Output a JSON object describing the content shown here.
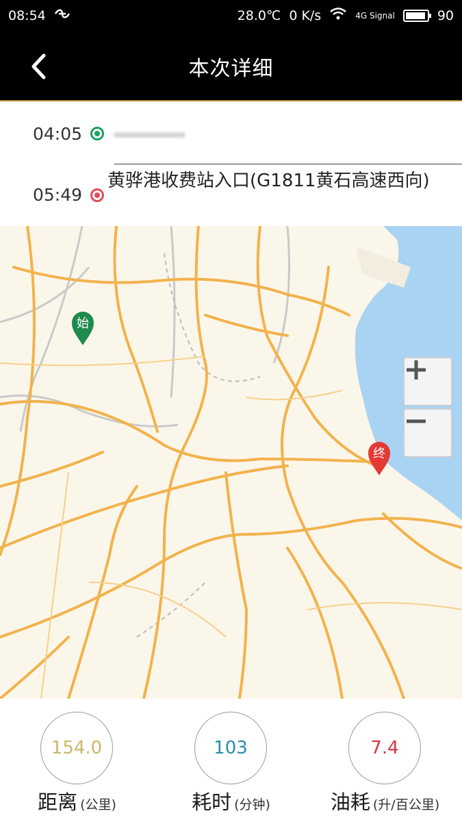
{
  "status_bar": {
    "time": "08:54",
    "temperature": "28.0℃",
    "speed": "0 K/s",
    "network": "4G Signal",
    "battery": "90"
  },
  "header": {
    "title": "本次详细",
    "back_icon": "chevron-left-icon"
  },
  "route": {
    "start_time": "04:05",
    "end_time": "05:49",
    "end_address": "黄骅港收费站入口(G1811黄石高速西向)",
    "start_color": "#1aa260",
    "end_color": "#e34b59"
  },
  "map": {
    "start_marker_label": "始",
    "end_marker_label": "终",
    "zoom_in_label": "+",
    "zoom_out_label": "−",
    "start_marker_color": "#1d8a4e",
    "end_marker_color": "#e53935",
    "sea_color": "#a9d3f2",
    "road_color": "#f2b24c"
  },
  "stats": {
    "distance": {
      "value": "154.0",
      "label": "距离",
      "unit": "(公里)",
      "color": "#c8b86a"
    },
    "duration": {
      "value": "103",
      "label": "耗时",
      "unit": "(分钟)",
      "color": "#2a8da5"
    },
    "fuel": {
      "value": "7.4",
      "label": "油耗",
      "unit": "(升/百公里)",
      "color": "#d9333f"
    }
  }
}
